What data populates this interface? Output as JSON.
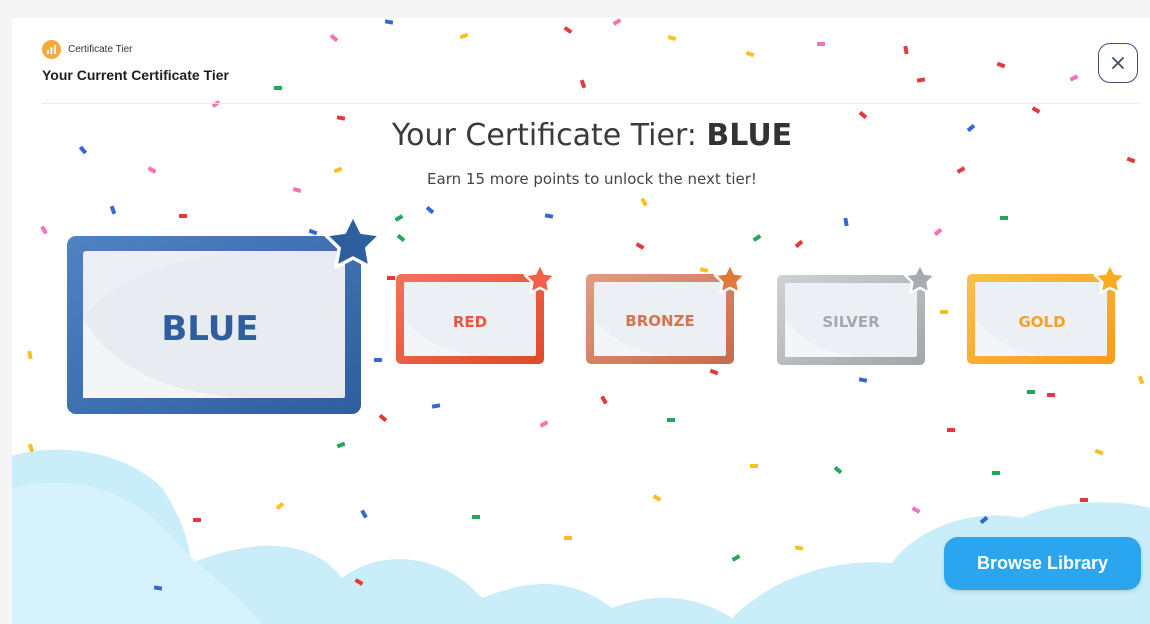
{
  "header": {
    "badge_label": "Certificate Tier",
    "title": "Your Current Certificate Tier"
  },
  "main": {
    "title_prefix": "Your Certificate Tier: ",
    "current_tier": "BLUE",
    "subtitle": "Earn 15 more points to unlock the next tier!"
  },
  "tiers": [
    {
      "name": "BLUE",
      "color": "#3565a6",
      "status": "current"
    },
    {
      "name": "RED",
      "color": "#ee5a3b"
    },
    {
      "name": "BRONZE",
      "color": "#d9795a"
    },
    {
      "name": "SILVER",
      "color": "#b4b6ba"
    },
    {
      "name": "GOLD",
      "color": "#fba82a"
    }
  ],
  "actions": {
    "browse_label": "Browse Library",
    "close_icon": "close-icon"
  },
  "colors": {
    "accent": "#2aa5ee",
    "cloud": "#c6ecf9",
    "badge": "#f7a93b"
  }
}
